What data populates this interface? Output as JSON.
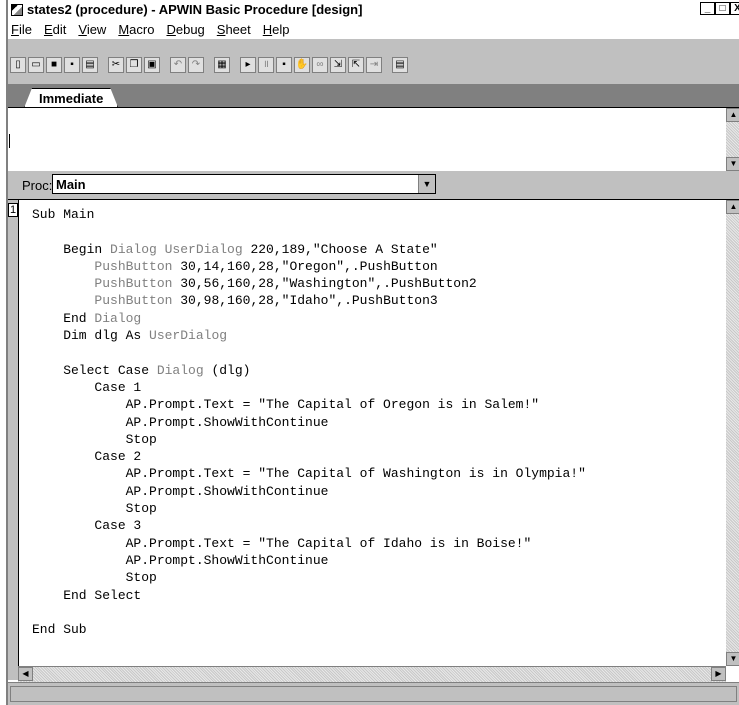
{
  "window": {
    "title": "states2 (procedure) - APWIN Basic Procedure [design]",
    "minimize_glyph": "_",
    "restore_glyph": "□",
    "close_glyph": "X"
  },
  "menu": {
    "items": [
      {
        "hotkey": "F",
        "rest": "ile"
      },
      {
        "hotkey": "E",
        "rest": "dit"
      },
      {
        "hotkey": "V",
        "rest": "iew"
      },
      {
        "hotkey": "M",
        "rest": "acro"
      },
      {
        "hotkey": "D",
        "rest": "ebug"
      },
      {
        "hotkey": "S",
        "rest": "heet"
      },
      {
        "hotkey": "H",
        "rest": "elp"
      }
    ]
  },
  "toolbar": {
    "icons": [
      "new-file-icon",
      "open-folder-icon",
      "save-icon",
      "save-all-icon",
      "print-icon",
      "cut-icon",
      "copy-icon",
      "paste-icon",
      "undo-icon",
      "redo-icon",
      "dialog-editor-icon",
      "run-icon",
      "pause-icon",
      "stop-icon",
      "toggle-breakpoint-icon",
      "quick-watch-icon",
      "step-into-icon",
      "step-over-icon",
      "step-out-icon",
      "sheet-icon"
    ]
  },
  "immediate": {
    "tab_label": "Immediate",
    "content": ""
  },
  "proc": {
    "label": "Proc:",
    "value": "Main"
  },
  "editor": {
    "line_number": "1"
  }
}
